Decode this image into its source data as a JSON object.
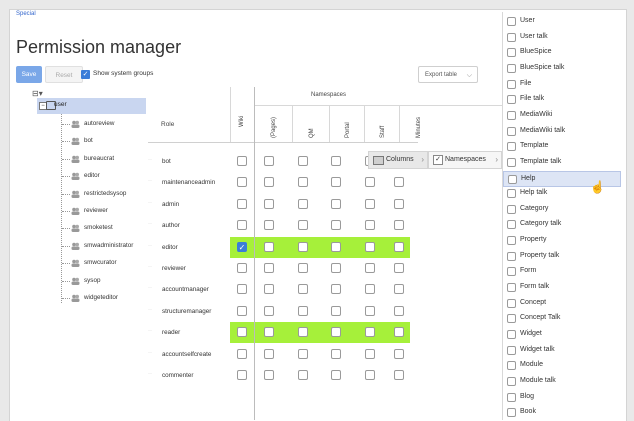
{
  "breadcrumb": {
    "special": "Special"
  },
  "page": {
    "title": "Permission manager"
  },
  "toolbar": {
    "save_label": "Save",
    "reset_label": "Reset",
    "show_system_groups_label": "Show system groups",
    "show_system_groups_checked": true,
    "export_label": "Export table"
  },
  "tree": {
    "root_label": "",
    "selected": "user",
    "children": [
      "autoreview",
      "bot",
      "bureaucrat",
      "editor",
      "restrictedsysop",
      "reviewer",
      "smoketest",
      "smwadministrator",
      "smwcurator",
      "sysop",
      "widgeteditor"
    ]
  },
  "grid": {
    "role_header": "Role",
    "wiki_header": "Wiki",
    "namespaces_header": "Namespaces",
    "namespace_columns": [
      "(Pages)",
      "QM",
      "Portal",
      "Staff",
      "Minutes"
    ],
    "rows": [
      {
        "role": "bot",
        "highlight": false,
        "wiki": false
      },
      {
        "role": "maintenanceadmin",
        "highlight": false,
        "wiki": false
      },
      {
        "role": "admin",
        "highlight": false,
        "wiki": false
      },
      {
        "role": "author",
        "highlight": false,
        "wiki": false
      },
      {
        "role": "editor",
        "highlight": true,
        "wiki": true
      },
      {
        "role": "reviewer",
        "highlight": false,
        "wiki": false
      },
      {
        "role": "accountmanager",
        "highlight": false,
        "wiki": false
      },
      {
        "role": "structuremanager",
        "highlight": false,
        "wiki": false
      },
      {
        "role": "reader",
        "highlight": true,
        "wiki": false
      },
      {
        "role": "accountselfcreate",
        "highlight": false,
        "wiki": false
      },
      {
        "role": "commenter",
        "highlight": false,
        "wiki": false
      }
    ]
  },
  "column_menu": {
    "columns_label": "Columns",
    "namespaces_label": "Namespaces"
  },
  "namespace_panel": {
    "hovered": "Help",
    "items": [
      "User",
      "User talk",
      "BlueSpice",
      "BlueSpice talk",
      "File",
      "File talk",
      "MediaWiki",
      "MediaWiki talk",
      "Template",
      "Template talk",
      "Help",
      "Help talk",
      "Category",
      "Category talk",
      "Property",
      "Property talk",
      "Form",
      "Form talk",
      "Concept",
      "Concept Talk",
      "Widget",
      "Widget talk",
      "Module",
      "Module talk",
      "Blog",
      "Book"
    ]
  },
  "colors": {
    "accent": "#3b7dd8",
    "highlight": "#a6f03a",
    "selected_row": "#c9d6f0"
  }
}
